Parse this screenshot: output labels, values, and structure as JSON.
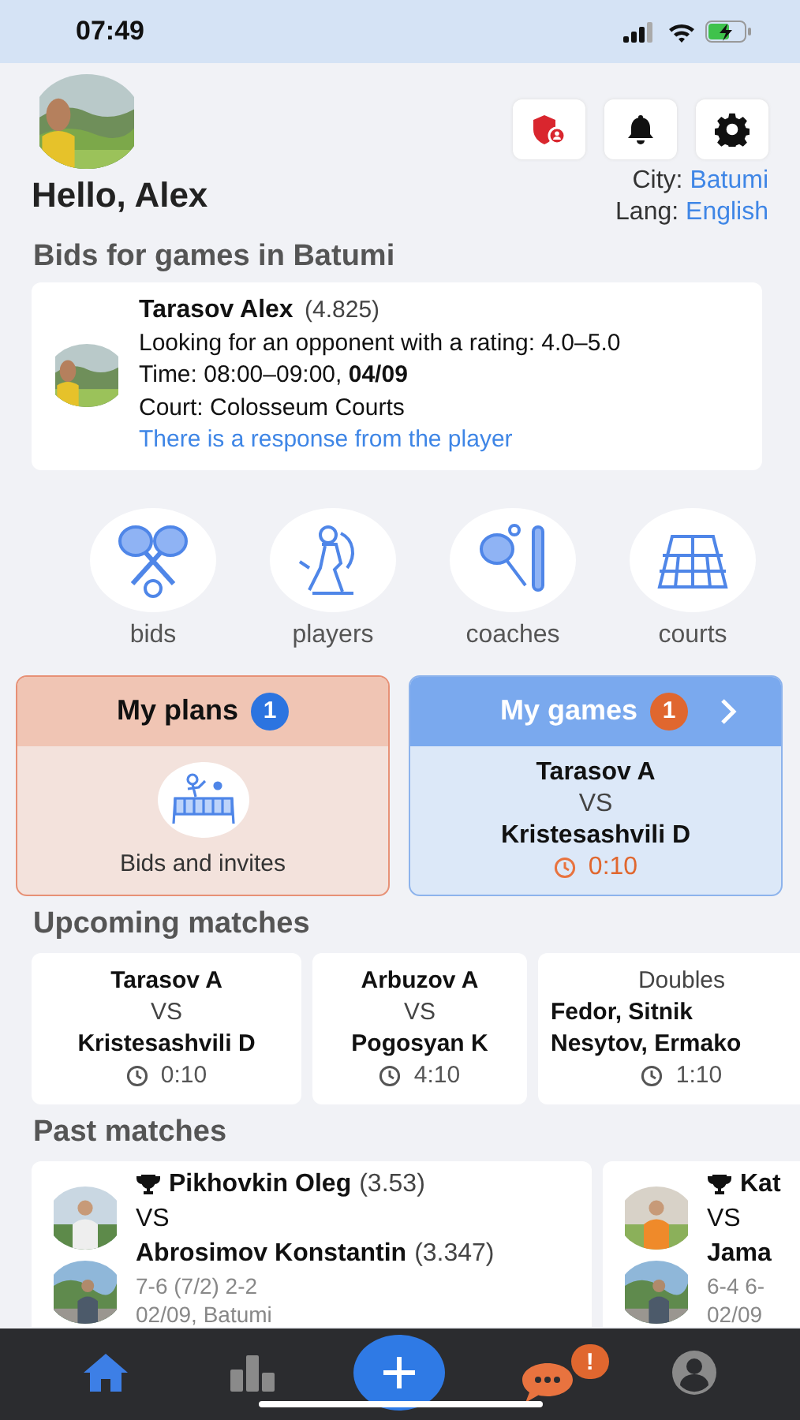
{
  "status_bar": {
    "time": "07:49"
  },
  "header": {
    "greeting": "Hello, Alex",
    "city_label": "City:",
    "city": "Batumi",
    "lang_label": "Lang:",
    "lang": "English",
    "buttons": [
      {
        "kind": "shield"
      },
      {
        "kind": "bell"
      },
      {
        "kind": "settings"
      }
    ]
  },
  "bids_section": {
    "title": "Bids for games in Batumi",
    "bid": {
      "name": "Tarasov Alex",
      "rating": "(4.825)",
      "lines": [
        "Looking for an opponent with a rating: 4.0–5.0",
        "Time: 08:00–09:00, **04/09**",
        "Court: Colosseum Courts"
      ],
      "response": "There is a response from the player"
    }
  },
  "categories": [
    {
      "label": "bids",
      "kind": "rackets"
    },
    {
      "label": "players",
      "kind": "player"
    },
    {
      "label": "coaches",
      "kind": "coach"
    },
    {
      "label": "courts",
      "kind": "court"
    }
  ],
  "my_plans": {
    "title": "My plans",
    "badge": "1",
    "label": "Bids and invites"
  },
  "my_games": {
    "title": "My games",
    "badge": "1",
    "player1": "Tarasov A",
    "vs": "VS",
    "player2": "Kristesashvili D",
    "time": "0:10"
  },
  "upcoming": {
    "title": "Upcoming matches",
    "matches": [
      {
        "kind": "singles",
        "player1": "Tarasov A",
        "vs": "VS",
        "player2": "Kristesashvili D",
        "time": "0:10"
      },
      {
        "kind": "singles",
        "player1": "Arbuzov A",
        "vs": "VS",
        "player2": "Pogosyan K",
        "time": "4:10"
      },
      {
        "kind": "doubles",
        "label": "Doubles",
        "player1": "Fedor, Sitnik",
        "player2": "Nesytov, Ermako",
        "time": "1:10"
      }
    ]
  },
  "past": {
    "title": "Past matches",
    "matches": [
      {
        "winner": "Pikhovkin Oleg",
        "winner_rating": "(3.53)",
        "vs": "VS",
        "loser": "Abrosimov Konstantin",
        "loser_rating": "(3.347)",
        "score": "7-6 (7/2)  2-2",
        "info": "02/09, Batumi"
      },
      {
        "winner": "Kat",
        "vs": "VS",
        "loser": "Jama",
        "score": "6-4  6-",
        "info": "02/09"
      }
    ]
  },
  "tab_bar": [
    {
      "kind": "home",
      "selected": true
    },
    {
      "kind": "stats",
      "selected": false
    },
    {
      "kind": "add",
      "selected": false
    },
    {
      "kind": "chat",
      "selected": false,
      "badge": "!"
    },
    {
      "kind": "profile",
      "selected": false
    }
  ]
}
